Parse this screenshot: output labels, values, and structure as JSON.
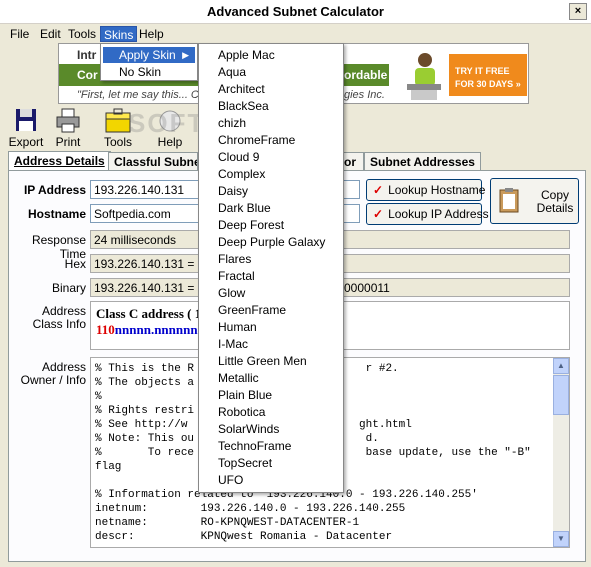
{
  "window": {
    "title": "Advanced Subnet Calculator",
    "close_glyph": "×"
  },
  "menubar": {
    "items": [
      "File",
      "Edit",
      "Tools",
      "Skins",
      "Help"
    ]
  },
  "banner": {
    "line1": "Intr",
    "line2": "Cor",
    "line3": "\"First, let me say this... Ci",
    "line2b": "ordable",
    "line3b": "gies Inc.",
    "promo_line1": "TRY IT FREE",
    "promo_line2": "FOR 30 DAYS »"
  },
  "toolbar": {
    "items": [
      "Export",
      "Print",
      "Tools",
      "Help"
    ]
  },
  "watermark": "SOFTPEDIA",
  "tabs": [
    "Address Details",
    "Classful Subnet",
    "or",
    "Subnet Addresses"
  ],
  "form": {
    "ip_label": "IP Address",
    "ip_value": "193.226.140.131",
    "host_label": "Hostname",
    "host_value": "Softpedia.com",
    "lookup_hostname": "Lookup Hostname",
    "lookup_ip": "Lookup IP Address",
    "copy_line1": "Copy",
    "copy_line2": "Details",
    "response_label": "Response Time",
    "response_value": "24 milliseconds",
    "hex_label": "Hex",
    "hex_value": "193.226.140.131 = C",
    "binary_label": "Binary",
    "binary_value": "193.226.140.131 = 11",
    "binary_tail": "0000011",
    "class_label_1": "Address",
    "class_label_2": "Class Info",
    "class_line1": "Class C address ( 1",
    "class_bits_red": "110",
    "class_bits_blue": "nnnnn.nnnnnnnn",
    "owner_label_1": "Address",
    "owner_label_2": "Owner / Info",
    "owner_text": "% This is the R                          r #2.\n% The objects a\n%\n% Rights restri\n% See http://w                          ght.html\n% Note: This ou                          d.\n%       To rece                          base update, use the \"-B\"\nflag\n\n% Information related to '193.226.140.0 - 193.226.140.255'\ninetnum:        193.226.140.0 - 193.226.140.255\nnetname:        RO-KPNQWEST-DATACENTER-1\ndescr:          KPNQwest Romania - Datacenter"
  },
  "skins_menu": {
    "apply_skin": "Apply Skin",
    "no_skin": "No Skin"
  },
  "skins": [
    "Apple Mac",
    "Aqua",
    "Architect",
    "BlackSea",
    "chizh",
    "ChromeFrame",
    "Cloud 9",
    "Complex",
    "Daisy",
    "Dark Blue",
    "Deep Forest",
    "Deep Purple Galaxy",
    "Flares",
    "Fractal",
    "Glow",
    "GreenFrame",
    "Human",
    "I-Mac",
    "Little Green Men",
    "Metallic",
    "Plain Blue",
    "Robotica",
    "SolarWinds",
    "TechnoFrame",
    "TopSecret",
    "UFO"
  ],
  "colors": {
    "accent": "#316ac5",
    "face": "#ece9d8",
    "class_red": "#d00000",
    "class_blue": "#0000cc"
  }
}
